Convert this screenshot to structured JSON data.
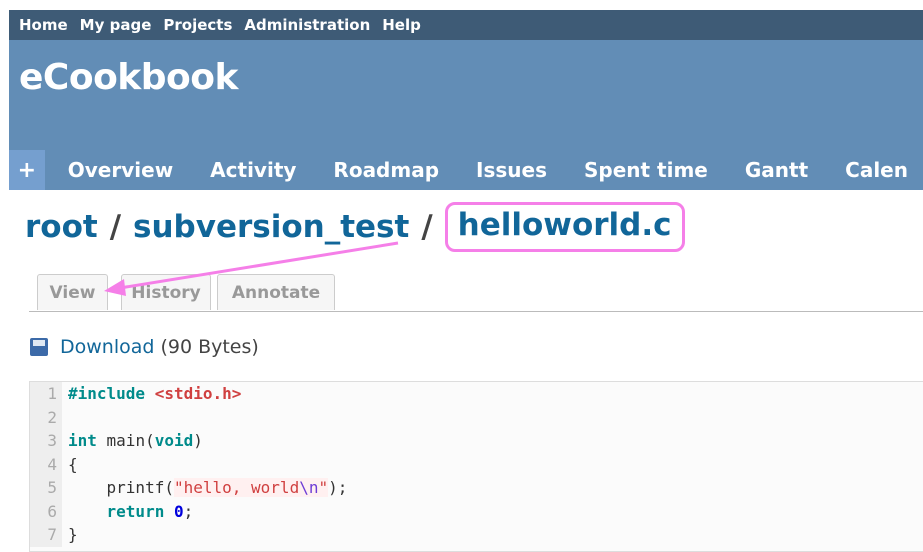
{
  "top_menu": {
    "items": [
      "Home",
      "My page",
      "Projects",
      "Administration",
      "Help"
    ]
  },
  "header": {
    "title": "eCookbook"
  },
  "main_menu": {
    "new_label": "+",
    "tabs": [
      "Overview",
      "Activity",
      "Roadmap",
      "Issues",
      "Spent time",
      "Gantt",
      "Calen"
    ]
  },
  "breadcrumb": {
    "root": "root",
    "separator": "/",
    "repo": "subversion_test",
    "file": "helloworld.c"
  },
  "file_tabs": {
    "view": "View",
    "history": "History",
    "annotate": "Annotate"
  },
  "download": {
    "label": "Download",
    "size": "(90 Bytes)"
  },
  "code": {
    "line_numbers": [
      "1",
      "2",
      "3",
      "4",
      "5",
      "6",
      "7"
    ],
    "lines": [
      "#include <stdio.h>",
      "",
      "int main(void)",
      "{",
      "    printf(\"hello, world\\n\");",
      "    return 0;",
      "}"
    ],
    "l1_directive": "#include ",
    "l1_header": "<stdio.h>",
    "l3_kw": "int",
    "l3_rest": " main(",
    "l3_kw2": "void",
    "l3_close": ")",
    "l4": "{",
    "l5_indent": "    printf(",
    "l5_str": "\"hello, world",
    "l5_esc": "\\n",
    "l5_strend": "\"",
    "l5_close": ");",
    "l6_indent": "    ",
    "l6_kw": "return",
    "l6_num": " 0",
    "l6_semi": ";",
    "l7": "}"
  },
  "colors": {
    "top_menu_bg": "#3e5b76",
    "header_bg": "#628db6",
    "link": "#116699",
    "highlight_annotation": "#f57fe8"
  },
  "icons": {
    "download": "floppy-disk-icon",
    "annotation": "arrow-annotation"
  }
}
